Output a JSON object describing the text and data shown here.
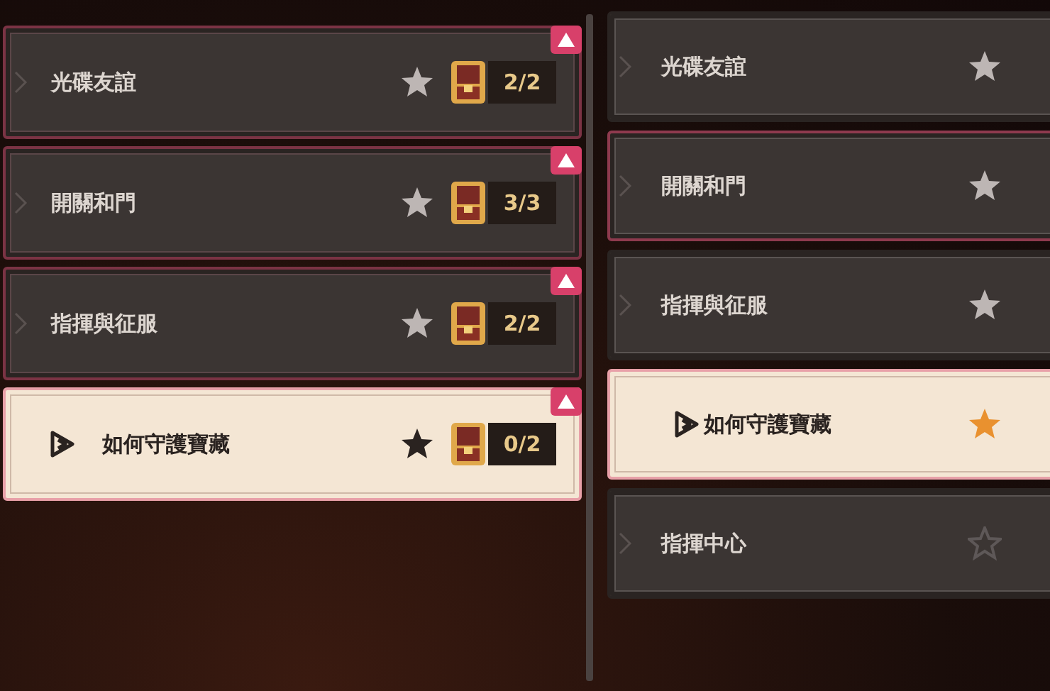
{
  "left_list": {
    "items": [
      {
        "title": "光碟友誼",
        "selected": false,
        "starred": true,
        "count": "2/2",
        "badge": true
      },
      {
        "title": "開關和門",
        "selected": false,
        "starred": true,
        "count": "3/3",
        "badge": true
      },
      {
        "title": "指揮與征服",
        "selected": false,
        "starred": true,
        "count": "2/2",
        "badge": true
      },
      {
        "title": "如何守護寶藏",
        "selected": true,
        "starred": true,
        "count": "0/2",
        "badge": true
      }
    ]
  },
  "right_list": {
    "items": [
      {
        "title": "光碟友誼",
        "selected": false,
        "starred": true,
        "star_highlighted": false,
        "outlined": false
      },
      {
        "title": "開關和門",
        "selected": false,
        "starred": true,
        "star_highlighted": false,
        "outlined": true
      },
      {
        "title": "指揮與征服",
        "selected": false,
        "starred": true,
        "star_highlighted": false,
        "outlined": false
      },
      {
        "title": "如何守護寶藏",
        "selected": true,
        "starred": true,
        "star_highlighted": true,
        "outlined": false
      },
      {
        "title": "指揮中心",
        "selected": false,
        "starred": false,
        "star_highlighted": false,
        "outlined": false
      }
    ]
  }
}
